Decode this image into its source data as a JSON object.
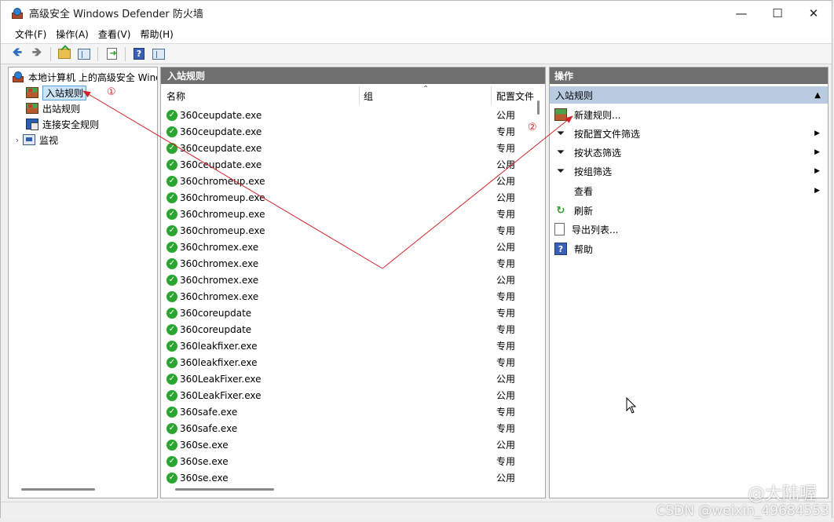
{
  "window": {
    "title": "高级安全 Windows Defender 防火墙",
    "controls": {
      "minimize": "—",
      "maximize": "☐",
      "close": "✕"
    }
  },
  "menu": [
    "文件(F)",
    "操作(A)",
    "查看(V)",
    "帮助(H)"
  ],
  "toolbar": [
    "back-icon",
    "forward-icon",
    "up-folder-icon",
    "show-tree-icon",
    "export-list-icon",
    "help-icon",
    "show-action-pane-icon"
  ],
  "tree": {
    "root": "本地计算机 上的高级安全 Windows Defender 防火墙",
    "items": [
      {
        "label": "入站规则",
        "selected": true
      },
      {
        "label": "出站规则"
      },
      {
        "label": "连接安全规则"
      },
      {
        "label": "监视",
        "expandable": true
      }
    ]
  },
  "middle": {
    "title": "入站规则",
    "columns": {
      "name": "名称",
      "group": "组",
      "profile": "配置文件"
    },
    "rows": [
      {
        "name": "360ceupdate.exe",
        "profile": "公用"
      },
      {
        "name": "360ceupdate.exe",
        "profile": "专用"
      },
      {
        "name": "360ceupdate.exe",
        "profile": "专用"
      },
      {
        "name": "360ceupdate.exe",
        "profile": "公用"
      },
      {
        "name": "360chromeup.exe",
        "profile": "公用"
      },
      {
        "name": "360chromeup.exe",
        "profile": "公用"
      },
      {
        "name": "360chromeup.exe",
        "profile": "专用"
      },
      {
        "name": "360chromeup.exe",
        "profile": "专用"
      },
      {
        "name": "360chromex.exe",
        "profile": "公用"
      },
      {
        "name": "360chromex.exe",
        "profile": "专用"
      },
      {
        "name": "360chromex.exe",
        "profile": "公用"
      },
      {
        "name": "360chromex.exe",
        "profile": "专用"
      },
      {
        "name": "360coreupdate",
        "profile": "专用"
      },
      {
        "name": "360coreupdate",
        "profile": "专用"
      },
      {
        "name": "360leakfixer.exe",
        "profile": "专用"
      },
      {
        "name": "360leakfixer.exe",
        "profile": "专用"
      },
      {
        "name": "360LeakFixer.exe",
        "profile": "公用"
      },
      {
        "name": "360LeakFixer.exe",
        "profile": "公用"
      },
      {
        "name": "360safe.exe",
        "profile": "专用"
      },
      {
        "name": "360safe.exe",
        "profile": "专用"
      },
      {
        "name": "360se.exe",
        "profile": "公用"
      },
      {
        "name": "360se.exe",
        "profile": "专用"
      },
      {
        "name": "360se.exe",
        "profile": "公用"
      }
    ]
  },
  "actions": {
    "title": "操作",
    "section": "入站规则",
    "items": [
      {
        "label": "新建规则...",
        "icon": "new-rule-icon"
      },
      {
        "label": "按配置文件筛选",
        "icon": "filter-icon",
        "submenu": true
      },
      {
        "label": "按状态筛选",
        "icon": "filter-icon",
        "submenu": true
      },
      {
        "label": "按组筛选",
        "icon": "filter-icon",
        "submenu": true
      },
      {
        "label": "查看",
        "icon": "",
        "submenu": true
      },
      {
        "label": "刷新",
        "icon": "refresh-icon"
      },
      {
        "label": "导出列表...",
        "icon": "export-icon"
      },
      {
        "label": "帮助",
        "icon": "help-icon"
      }
    ]
  },
  "annotations": {
    "marker1": "①",
    "marker2": "②",
    "color": "#d1232a"
  },
  "watermark": {
    "line1": "@大陆喔",
    "line2": "CSDN @weixin_49684553"
  }
}
